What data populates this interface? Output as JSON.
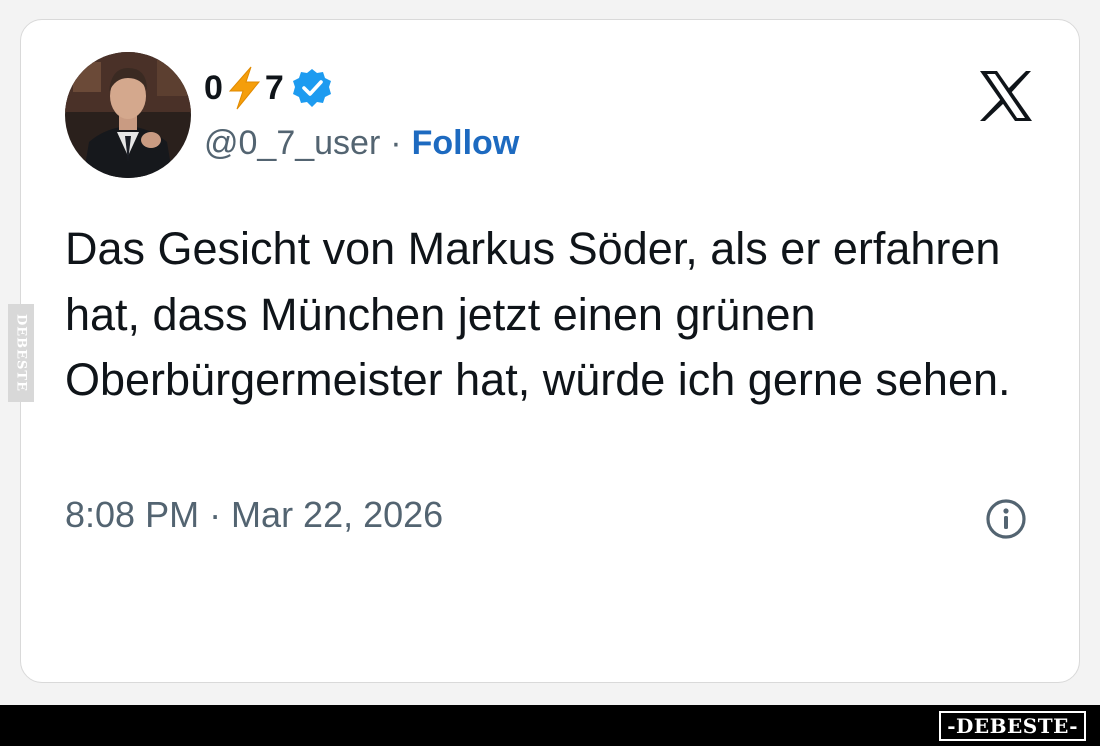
{
  "author": {
    "name_part1": "0",
    "name_emoji": "⚡",
    "name_part2": "7",
    "handle": "@0_7_user",
    "separator": "·",
    "follow_label": "Follow"
  },
  "tweet": {
    "text": "Das Gesicht von Markus Söder, als er erfahren hat, dass München jetzt einen grünen Oberbürgermeister hat, würde ich gerne sehen.",
    "timestamp": "8:08 PM · Mar 22, 2026"
  },
  "watermark": {
    "side_text": "DEBESTE",
    "footer_text": "-DEBESTE-"
  },
  "icons": {
    "platform": "x-logo-icon",
    "verified": "verified-badge-icon",
    "info": "info-icon"
  },
  "colors": {
    "follow": "#1d6ac0",
    "verified": "#1d9bf0",
    "text": "#0f1419",
    "muted": "#536471"
  }
}
